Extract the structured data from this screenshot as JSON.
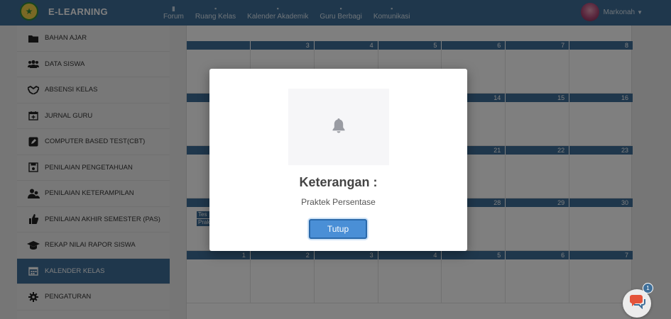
{
  "brand": {
    "logo_icon": "school-emblem-icon",
    "name": "E-LEARNING"
  },
  "nav": [
    {
      "label": "Forum",
      "icon": "home-icon"
    },
    {
      "label": "Ruang Kelas",
      "icon": "class-icon"
    },
    {
      "label": "Kalender Akademik",
      "icon": "calendar-icon"
    },
    {
      "label": "Guru Berbagi",
      "icon": "user-icon"
    },
    {
      "label": "Komunikasi",
      "icon": "mail-icon"
    }
  ],
  "user": {
    "name": "Markonah"
  },
  "sidebar": {
    "items": [
      {
        "label": "BAHAN AJAR",
        "icon": "folder-icon"
      },
      {
        "label": "DATA SISWA",
        "icon": "users-icon"
      },
      {
        "label": "ABSENSI KELAS",
        "icon": "handshake-icon"
      },
      {
        "label": "JURNAL GURU",
        "icon": "calendar-plus-icon"
      },
      {
        "label": "COMPUTER BASED TEST(CBT)",
        "icon": "edit-square-icon"
      },
      {
        "label": "PENILAIAN PENGETAHUAN",
        "icon": "save-icon"
      },
      {
        "label": "PENILAIAN KETERAMPILAN",
        "icon": "group-icon"
      },
      {
        "label": "PENILAIAN AKHIR SEMESTER (PAS)",
        "icon": "thumbs-up-icon"
      },
      {
        "label": "REKAP NILAI RAPOR SISWA",
        "icon": "graduation-cap-icon"
      },
      {
        "label": "KALENDER KELAS",
        "icon": "calendar-icon",
        "active": true
      },
      {
        "label": "PENGATURAN",
        "icon": "gear-icon"
      }
    ]
  },
  "calendar": {
    "weeks": [
      [
        "",
        "3",
        "4",
        "5",
        "6",
        "7",
        "8",
        "9"
      ],
      [
        "",
        "",
        "",
        "",
        "",
        "14",
        "15",
        "16"
      ],
      [
        "",
        "",
        "",
        "",
        "",
        "21",
        "22",
        "23"
      ],
      [
        "",
        "",
        "",
        "",
        "",
        "28",
        "29",
        "30"
      ],
      [
        "",
        "1",
        "2",
        "3",
        "4",
        "5",
        "6",
        "7"
      ]
    ],
    "events": [
      "Tes",
      "Prak"
    ]
  },
  "modal": {
    "icon": "bell-icon",
    "title": "Keterangan :",
    "text": "Praktek Persentase",
    "button": "Tutup"
  },
  "chat": {
    "icon": "chat-bubble-icon",
    "badge": "1"
  },
  "colors": {
    "primary": "#3f6f99",
    "button": "#4a8fd6"
  }
}
